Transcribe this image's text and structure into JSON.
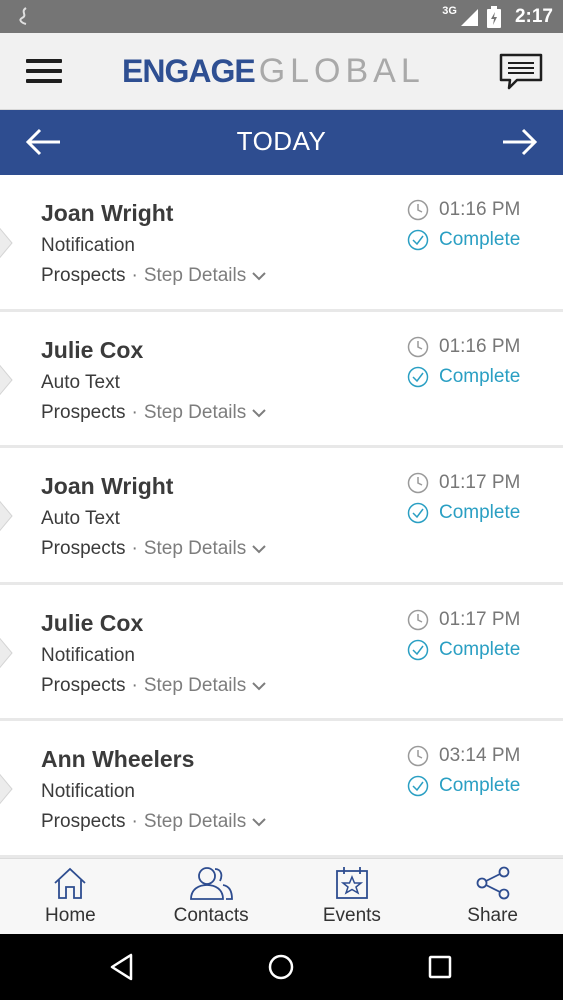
{
  "status_bar": {
    "network": "3G",
    "time": "2:17"
  },
  "app_bar": {
    "logo_primary": "ENGAGE",
    "logo_secondary": "GLOBAL",
    "brand_color": "#2e4d90"
  },
  "date_nav": {
    "title": "TODAY"
  },
  "activities": [
    {
      "name": "Joan Wright",
      "type": "Notification",
      "category": "Prospects",
      "separator": "·",
      "details": "Step Details",
      "time": "01:16 PM",
      "status": "Complete"
    },
    {
      "name": "Julie Cox",
      "type": "Auto Text",
      "category": "Prospects",
      "separator": "·",
      "details": "Step Details",
      "time": "01:16 PM",
      "status": "Complete"
    },
    {
      "name": "Joan Wright",
      "type": "Auto Text",
      "category": "Prospects",
      "separator": "·",
      "details": "Step Details",
      "time": "01:17 PM",
      "status": "Complete"
    },
    {
      "name": "Julie Cox",
      "type": "Notification",
      "category": "Prospects",
      "separator": "·",
      "details": "Step Details",
      "time": "01:17 PM",
      "status": "Complete"
    },
    {
      "name": "Ann Wheelers",
      "type": "Notification",
      "category": "Prospects",
      "separator": "·",
      "details": "Step Details",
      "time": "03:14 PM",
      "status": "Complete"
    }
  ],
  "tabs": [
    {
      "label": "Home",
      "icon": "home-icon"
    },
    {
      "label": "Contacts",
      "icon": "contacts-icon"
    },
    {
      "label": "Events",
      "icon": "events-icon"
    },
    {
      "label": "Share",
      "icon": "share-icon"
    }
  ],
  "colors": {
    "status_complete": "#2a9fc3",
    "date_bar": "#2e4d90"
  }
}
